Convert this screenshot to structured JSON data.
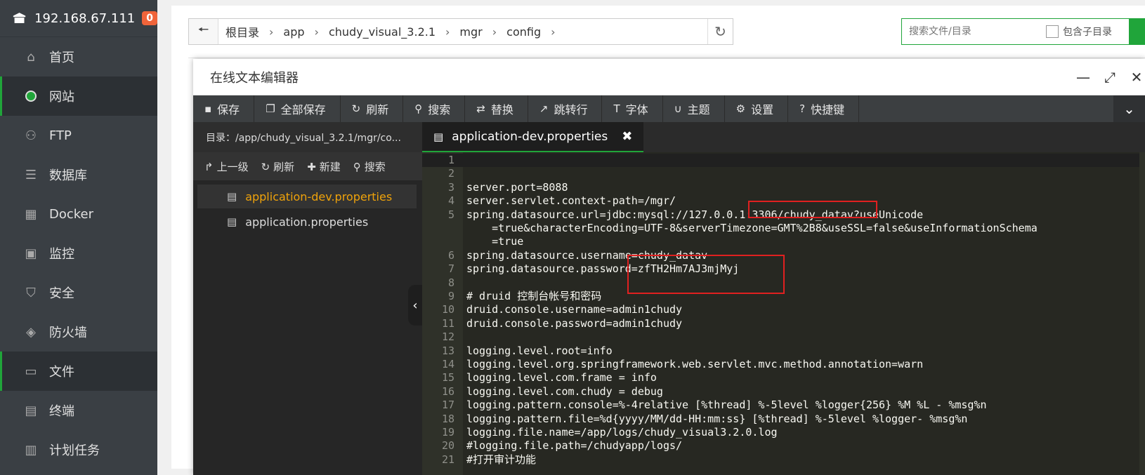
{
  "sidebar": {
    "server_ip": "192.168.67.111",
    "badge": "0",
    "items": [
      {
        "label": "首页",
        "icon": "home-icon"
      },
      {
        "label": "网站",
        "icon": "globe-icon"
      },
      {
        "label": "FTP",
        "icon": "ftp-icon"
      },
      {
        "label": "数据库",
        "icon": "database-icon"
      },
      {
        "label": "Docker",
        "icon": "docker-icon"
      },
      {
        "label": "监控",
        "icon": "monitor-icon"
      },
      {
        "label": "安全",
        "icon": "shield-icon"
      },
      {
        "label": "防火墙",
        "icon": "firewall-icon"
      },
      {
        "label": "文件",
        "icon": "folder-icon"
      },
      {
        "label": "终端",
        "icon": "terminal-icon"
      },
      {
        "label": "计划任务",
        "icon": "calendar-icon"
      }
    ]
  },
  "breadcrumb": {
    "items": [
      "根目录",
      "app",
      "chudy_visual_3.2.1",
      "mgr",
      "config"
    ]
  },
  "search": {
    "placeholder": "搜索文件/目录",
    "subdir_label": "包含子目录"
  },
  "editor": {
    "title": "在线文本编辑器",
    "toolbar": [
      {
        "label": "保存",
        "icon": "save-icon"
      },
      {
        "label": "全部保存",
        "icon": "save-all-icon"
      },
      {
        "label": "刷新",
        "icon": "refresh-icon"
      },
      {
        "label": "搜索",
        "icon": "search-icon"
      },
      {
        "label": "替换",
        "icon": "replace-icon"
      },
      {
        "label": "跳转行",
        "icon": "jump-icon"
      },
      {
        "label": "字体",
        "icon": "font-icon"
      },
      {
        "label": "主题",
        "icon": "theme-icon"
      },
      {
        "label": "设置",
        "icon": "gear-icon"
      },
      {
        "label": "快捷键",
        "icon": "help-icon"
      }
    ],
    "dir_path": "目录：/app/chudy_visual_3.2.1/mgr/co...",
    "actions": [
      "上一级",
      "刷新",
      "新建",
      "搜索"
    ],
    "files": [
      "application-dev.properties",
      "application.properties"
    ],
    "active_tab": "application-dev.properties",
    "lines": [
      {
        "n": "1",
        "t": ""
      },
      {
        "n": "2",
        "t": ""
      },
      {
        "n": "3",
        "t": "server.port=8088"
      },
      {
        "n": "4",
        "t": "server.servlet.context-path=/mgr/"
      },
      {
        "n": "5",
        "t": "spring.datasource.url=jdbc:mysql://127.0.0.1:3306/chudy_datav?useUnicode"
      },
      {
        "n": "",
        "t": "    =true&characterEncoding=UTF-8&serverTimezone=GMT%2B8&useSSL=false&useInformationSchema"
      },
      {
        "n": "",
        "t": "    =true"
      },
      {
        "n": "6",
        "t": "spring.datasource.username=chudy_datav"
      },
      {
        "n": "7",
        "t": "spring.datasource.password=zfTH2Hm7AJ3mjMyj"
      },
      {
        "n": "8",
        "t": ""
      },
      {
        "n": "9",
        "t": "# druid 控制台帐号和密码"
      },
      {
        "n": "10",
        "t": "druid.console.username=admin1chudy"
      },
      {
        "n": "11",
        "t": "druid.console.password=admin1chudy"
      },
      {
        "n": "12",
        "t": ""
      },
      {
        "n": "13",
        "t": "logging.level.root=info"
      },
      {
        "n": "14",
        "t": "logging.level.org.springframework.web.servlet.mvc.method.annotation=warn"
      },
      {
        "n": "15",
        "t": "logging.level.com.frame = info"
      },
      {
        "n": "16",
        "t": "logging.level.com.chudy = debug"
      },
      {
        "n": "17",
        "t": "logging.pattern.console=%-4relative [%thread] %-5level %logger{256} %M %L - %msg%n"
      },
      {
        "n": "18",
        "t": "logging.pattern.file=%d{yyyy/MM/dd-HH:mm:ss} [%thread] %-5level %logger- %msg%n"
      },
      {
        "n": "19",
        "t": "logging.file.name=/app/logs/chudy_visual3.2.0.log"
      },
      {
        "n": "20",
        "t": "#logging.file.path=/chudyapp/logs/"
      },
      {
        "n": "21",
        "t": "#打开审计功能"
      }
    ]
  }
}
